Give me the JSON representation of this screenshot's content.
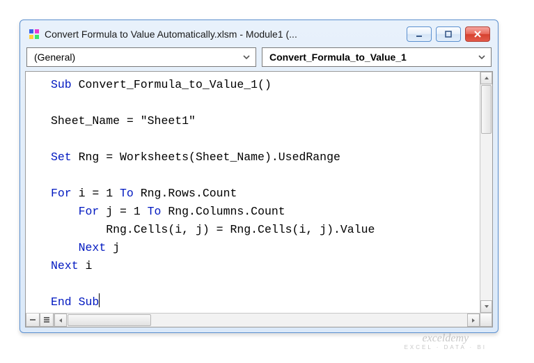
{
  "window": {
    "title": "Convert Formula to Value Automatically.xlsm - Module1 (..."
  },
  "dropdowns": {
    "left": "(General)",
    "right": "Convert_Formula_to_Value_1"
  },
  "code": {
    "line1_kw": "Sub",
    "line1_name": " Convert_Formula_to_Value_1()",
    "line2": "",
    "line3_a": "Sheet_Name = ",
    "line3_b": "\"Sheet1\"",
    "line4": "",
    "line5_kw": "Set",
    "line5_rest": " Rng = Worksheets(Sheet_Name).UsedRange",
    "line6": "",
    "line7_kw": "For",
    "line7_rest": " i = 1 ",
    "line7_kw2": "To",
    "line7_rest2": " Rng.Rows.Count",
    "line8_indent": "    ",
    "line8_kw": "For",
    "line8_rest": " j = 1 ",
    "line8_kw2": "To",
    "line8_rest2": " Rng.Columns.Count",
    "line9_indent": "        ",
    "line9_rest": "Rng.Cells(i, j) = Rng.Cells(i, j).Value",
    "line10_indent": "    ",
    "line10_kw": "Next",
    "line10_rest": " j",
    "line11_kw": "Next",
    "line11_rest": " i",
    "line12": "",
    "line13_kw": "End Sub"
  },
  "watermark": {
    "main": "exceldemy",
    "sub": "EXCEL · DATA · BI"
  }
}
